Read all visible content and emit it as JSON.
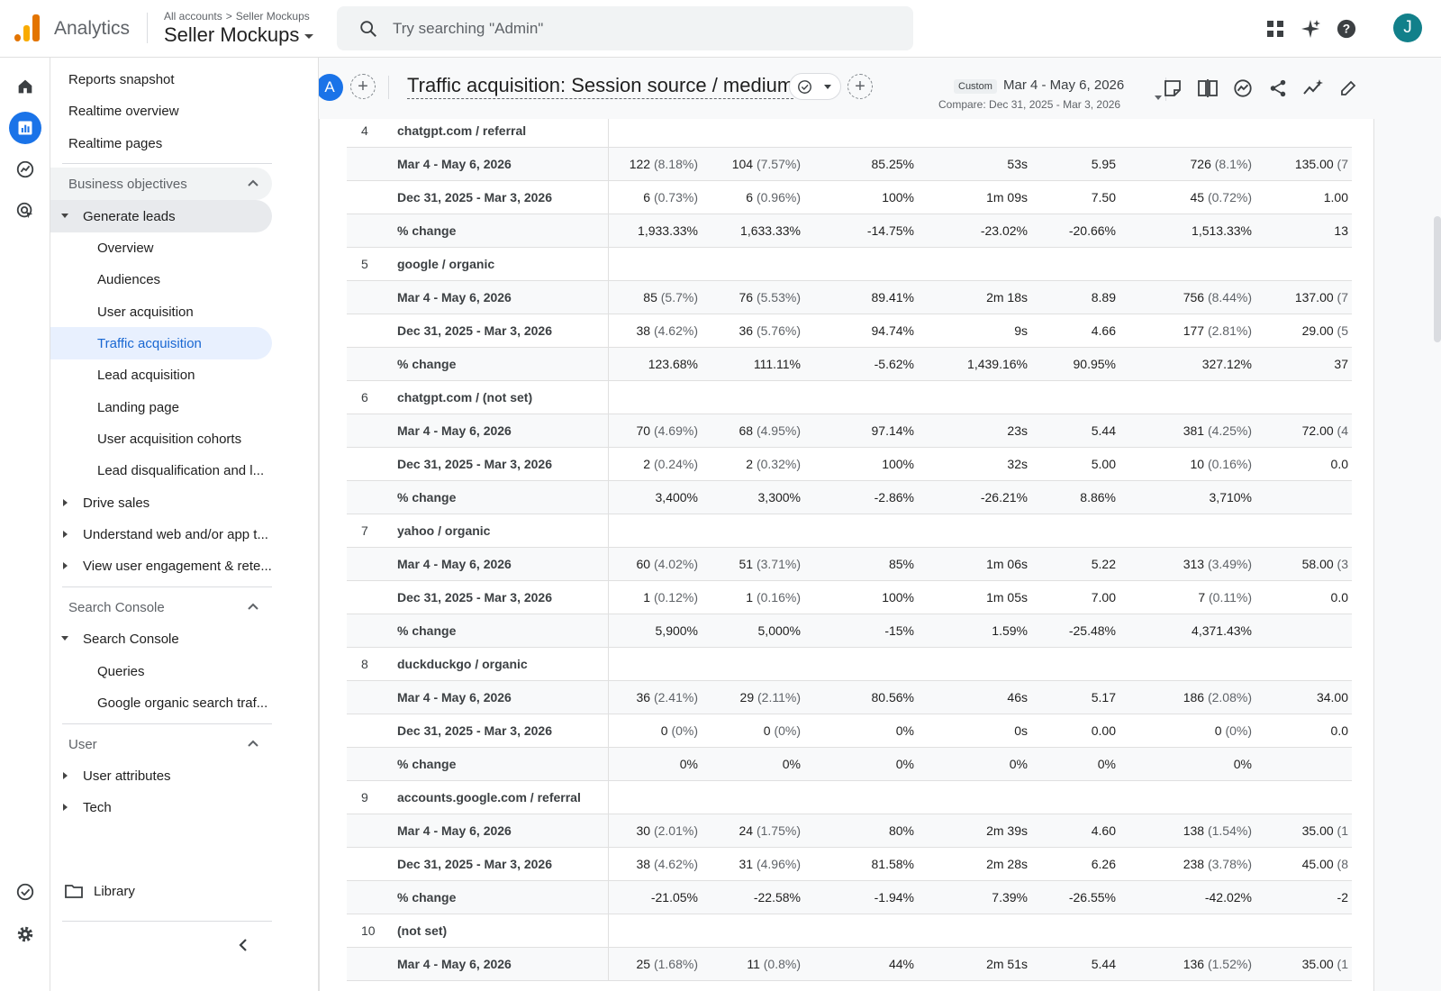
{
  "header": {
    "app_name": "Analytics",
    "breadcrumb": {
      "root": "All accounts",
      "sep": ">",
      "current": "Seller Mockups"
    },
    "account_name": "Seller Mockups",
    "search_placeholder": "Try searching \"Admin\"",
    "avatar_letter": "J"
  },
  "colors": {
    "accent": "#1a73e8",
    "selected_bg": "#e8f0fe",
    "avatar": "#12808a"
  },
  "sidebar": {
    "top_items": [
      "Reports snapshot",
      "Realtime overview",
      "Realtime pages"
    ],
    "business_objectives": {
      "title": "Business objectives",
      "generate_leads": {
        "label": "Generate leads",
        "children": [
          "Overview",
          "Audiences",
          "User acquisition",
          "Traffic acquisition",
          "Lead acquisition",
          "Landing page",
          "User acquisition cohorts",
          "Lead disqualification and l..."
        ],
        "selected": "Traffic acquisition"
      },
      "collapsed": [
        "Drive sales",
        "Understand web and/or app t...",
        "View user engagement & rete..."
      ]
    },
    "search_console": {
      "title": "Search Console",
      "group": "Search Console",
      "children": [
        "Queries",
        "Google organic search traf..."
      ]
    },
    "user": {
      "title": "User",
      "collapsed": [
        "User attributes",
        "Tech"
      ]
    },
    "library": "Library"
  },
  "report": {
    "comparison_badge": "A",
    "title": "Traffic acquisition: Session source / medium",
    "date_badge": "Custom",
    "date_range": "Mar 4 - May 6, 2026",
    "compare_range": "Compare: Dec 31, 2025 - Mar 3, 2026"
  },
  "table": {
    "rows": [
      {
        "index": "4",
        "source": "chatgpt.com / referral",
        "sub": [
          {
            "label": "Mar 4 - May 6, 2026",
            "c1": "122",
            "c1p": "(8.18%)",
            "c2": "104",
            "c2p": "(7.57%)",
            "c3": "85.25%",
            "c4": "53s",
            "c5": "5.95",
            "c6": "726",
            "c6p": "(8.1%)",
            "c7": "135.00",
            "c7p": "(7"
          },
          {
            "label": "Dec 31, 2025 - Mar 3, 2026",
            "c1": "6",
            "c1p": "(0.73%)",
            "c2": "6",
            "c2p": "(0.96%)",
            "c3": "100%",
            "c4": "1m 09s",
            "c5": "7.50",
            "c6": "45",
            "c6p": "(0.72%)",
            "c7": "1.00",
            "c7p": ""
          },
          {
            "label": "% change",
            "c1": "1,933.33%",
            "c1p": "",
            "c2": "1,633.33%",
            "c2p": "",
            "c3": "-14.75%",
            "c4": "-23.02%",
            "c5": "-20.66%",
            "c6": "1,513.33%",
            "c6p": "",
            "c7": "13",
            "c7p": ""
          }
        ]
      },
      {
        "index": "5",
        "source": "google / organic",
        "sub": [
          {
            "label": "Mar 4 - May 6, 2026",
            "c1": "85",
            "c1p": "(5.7%)",
            "c2": "76",
            "c2p": "(5.53%)",
            "c3": "89.41%",
            "c4": "2m 18s",
            "c5": "8.89",
            "c6": "756",
            "c6p": "(8.44%)",
            "c7": "137.00",
            "c7p": "(7"
          },
          {
            "label": "Dec 31, 2025 - Mar 3, 2026",
            "c1": "38",
            "c1p": "(4.62%)",
            "c2": "36",
            "c2p": "(5.76%)",
            "c3": "94.74%",
            "c4": "9s",
            "c5": "4.66",
            "c6": "177",
            "c6p": "(2.81%)",
            "c7": "29.00",
            "c7p": "(5"
          },
          {
            "label": "% change",
            "c1": "123.68%",
            "c1p": "",
            "c2": "111.11%",
            "c2p": "",
            "c3": "-5.62%",
            "c4": "1,439.16%",
            "c5": "90.95%",
            "c6": "327.12%",
            "c6p": "",
            "c7": "37",
            "c7p": ""
          }
        ]
      },
      {
        "index": "6",
        "source": "chatgpt.com / (not set)",
        "sub": [
          {
            "label": "Mar 4 - May 6, 2026",
            "c1": "70",
            "c1p": "(4.69%)",
            "c2": "68",
            "c2p": "(4.95%)",
            "c3": "97.14%",
            "c4": "23s",
            "c5": "5.44",
            "c6": "381",
            "c6p": "(4.25%)",
            "c7": "72.00",
            "c7p": "(4"
          },
          {
            "label": "Dec 31, 2025 - Mar 3, 2026",
            "c1": "2",
            "c1p": "(0.24%)",
            "c2": "2",
            "c2p": "(0.32%)",
            "c3": "100%",
            "c4": "32s",
            "c5": "5.00",
            "c6": "10",
            "c6p": "(0.16%)",
            "c7": "0.0",
            "c7p": ""
          },
          {
            "label": "% change",
            "c1": "3,400%",
            "c1p": "",
            "c2": "3,300%",
            "c2p": "",
            "c3": "-2.86%",
            "c4": "-26.21%",
            "c5": "8.86%",
            "c6": "3,710%",
            "c6p": "",
            "c7": "",
            "c7p": ""
          }
        ]
      },
      {
        "index": "7",
        "source": "yahoo / organic",
        "sub": [
          {
            "label": "Mar 4 - May 6, 2026",
            "c1": "60",
            "c1p": "(4.02%)",
            "c2": "51",
            "c2p": "(3.71%)",
            "c3": "85%",
            "c4": "1m 06s",
            "c5": "5.22",
            "c6": "313",
            "c6p": "(3.49%)",
            "c7": "58.00",
            "c7p": "(3"
          },
          {
            "label": "Dec 31, 2025 - Mar 3, 2026",
            "c1": "1",
            "c1p": "(0.12%)",
            "c2": "1",
            "c2p": "(0.16%)",
            "c3": "100%",
            "c4": "1m 05s",
            "c5": "7.00",
            "c6": "7",
            "c6p": "(0.11%)",
            "c7": "0.0",
            "c7p": ""
          },
          {
            "label": "% change",
            "c1": "5,900%",
            "c1p": "",
            "c2": "5,000%",
            "c2p": "",
            "c3": "-15%",
            "c4": "1.59%",
            "c5": "-25.48%",
            "c6": "4,371.43%",
            "c6p": "",
            "c7": "",
            "c7p": ""
          }
        ]
      },
      {
        "index": "8",
        "source": "duckduckgo / organic",
        "sub": [
          {
            "label": "Mar 4 - May 6, 2026",
            "c1": "36",
            "c1p": "(2.41%)",
            "c2": "29",
            "c2p": "(2.11%)",
            "c3": "80.56%",
            "c4": "46s",
            "c5": "5.17",
            "c6": "186",
            "c6p": "(2.08%)",
            "c7": "34.00",
            "c7p": ""
          },
          {
            "label": "Dec 31, 2025 - Mar 3, 2026",
            "c1": "0",
            "c1p": "(0%)",
            "c2": "0",
            "c2p": "(0%)",
            "c3": "0%",
            "c4": "0s",
            "c5": "0.00",
            "c6": "0",
            "c6p": "(0%)",
            "c7": "0.0",
            "c7p": ""
          },
          {
            "label": "% change",
            "c1": "0%",
            "c1p": "",
            "c2": "0%",
            "c2p": "",
            "c3": "0%",
            "c4": "0%",
            "c5": "0%",
            "c6": "0%",
            "c6p": "",
            "c7": "",
            "c7p": ""
          }
        ]
      },
      {
        "index": "9",
        "source": "accounts.google.com / referral",
        "sub": [
          {
            "label": "Mar 4 - May 6, 2026",
            "c1": "30",
            "c1p": "(2.01%)",
            "c2": "24",
            "c2p": "(1.75%)",
            "c3": "80%",
            "c4": "2m 39s",
            "c5": "4.60",
            "c6": "138",
            "c6p": "(1.54%)",
            "c7": "35.00",
            "c7p": "(1"
          },
          {
            "label": "Dec 31, 2025 - Mar 3, 2026",
            "c1": "38",
            "c1p": "(4.62%)",
            "c2": "31",
            "c2p": "(4.96%)",
            "c3": "81.58%",
            "c4": "2m 28s",
            "c5": "6.26",
            "c6": "238",
            "c6p": "(3.78%)",
            "c7": "45.00",
            "c7p": "(8"
          },
          {
            "label": "% change",
            "c1": "-21.05%",
            "c1p": "",
            "c2": "-22.58%",
            "c2p": "",
            "c3": "-1.94%",
            "c4": "7.39%",
            "c5": "-26.55%",
            "c6": "-42.02%",
            "c6p": "",
            "c7": "-2",
            "c7p": ""
          }
        ]
      },
      {
        "index": "10",
        "source": "(not set)",
        "sub": [
          {
            "label": "Mar 4 - May 6, 2026",
            "c1": "25",
            "c1p": "(1.68%)",
            "c2": "11",
            "c2p": "(0.8%)",
            "c3": "44%",
            "c4": "2m 51s",
            "c5": "5.44",
            "c6": "136",
            "c6p": "(1.52%)",
            "c7": "35.00",
            "c7p": "(1"
          }
        ]
      }
    ]
  }
}
